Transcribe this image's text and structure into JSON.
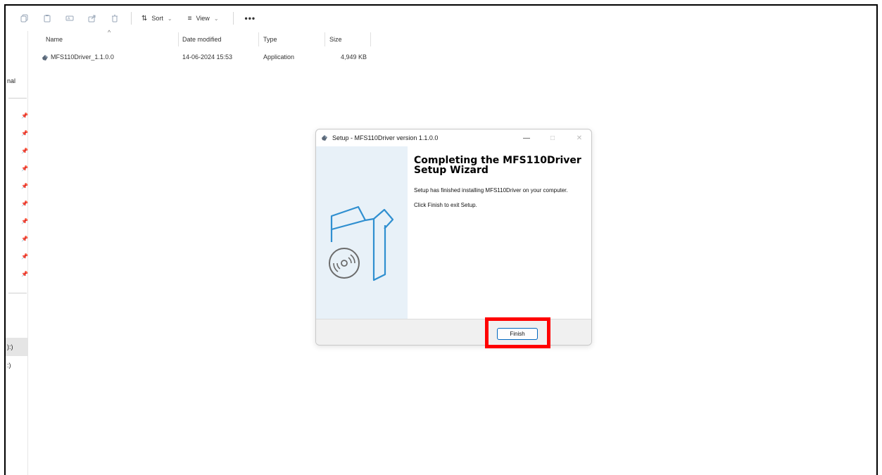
{
  "toolbar": {
    "icons": [
      "copy-icon",
      "paste-icon",
      "rename-icon",
      "share-icon",
      "delete-icon"
    ],
    "sort_label": "Sort",
    "view_label": "View",
    "more_label": "•••"
  },
  "nav": {
    "fragment_top": "nal",
    "fragment_drive1": "):)",
    "fragment_drive2": ":)",
    "pinned_count": 10
  },
  "columns": {
    "name": "Name",
    "date_modified": "Date modified",
    "type": "Type",
    "size": "Size"
  },
  "files": [
    {
      "name": "MFS110Driver_1.1.0.0",
      "date_modified": "14-06-2024 15:53",
      "type": "Application",
      "size": "4,949 KB"
    }
  ],
  "dialog": {
    "title": "Setup - MFS110Driver version 1.1.0.0",
    "heading_line1": "Completing the MFS110Driver",
    "heading_line2": "Setup Wizard",
    "message1": "Setup has finished installing MFS110Driver on your computer.",
    "message2": "Click Finish to exit Setup.",
    "finish_label": "Finish",
    "minimize_glyph": "—",
    "maximize_glyph": "□",
    "close_glyph": "✕"
  },
  "colors": {
    "accent": "#0067c0",
    "highlight": "#ff0000",
    "sidebar_bg": "#e8f1f8",
    "illustration": "#2f8fd0"
  }
}
